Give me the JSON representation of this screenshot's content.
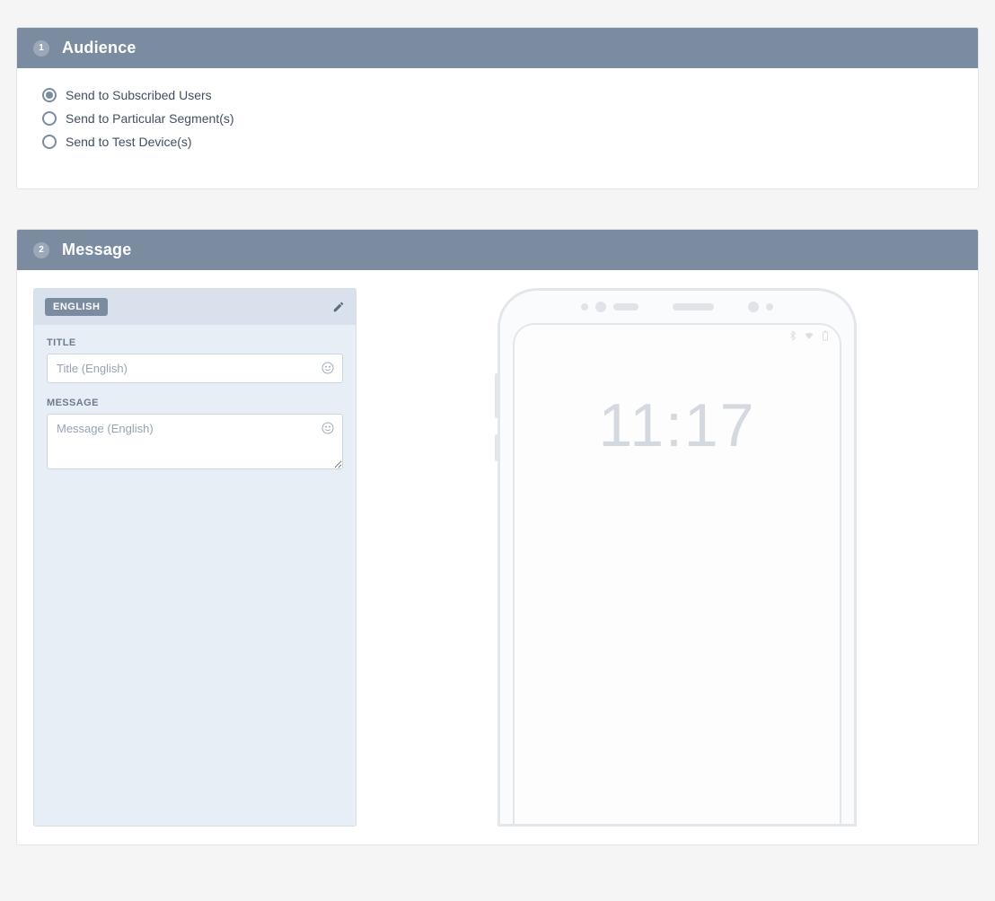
{
  "sections": {
    "audience": {
      "step": "1",
      "title": "Audience",
      "options": [
        {
          "label": "Send to Subscribed Users",
          "selected": true
        },
        {
          "label": "Send to Particular Segment(s)",
          "selected": false
        },
        {
          "label": "Send to Test Device(s)",
          "selected": false
        }
      ]
    },
    "message": {
      "step": "2",
      "title": "Message",
      "language_pill": "ENGLISH",
      "fields": {
        "title_label": "TITLE",
        "title_placeholder": "Title (English)",
        "message_label": "MESSAGE",
        "message_placeholder": "Message (English)"
      }
    }
  },
  "preview": {
    "clock": "11:17"
  }
}
